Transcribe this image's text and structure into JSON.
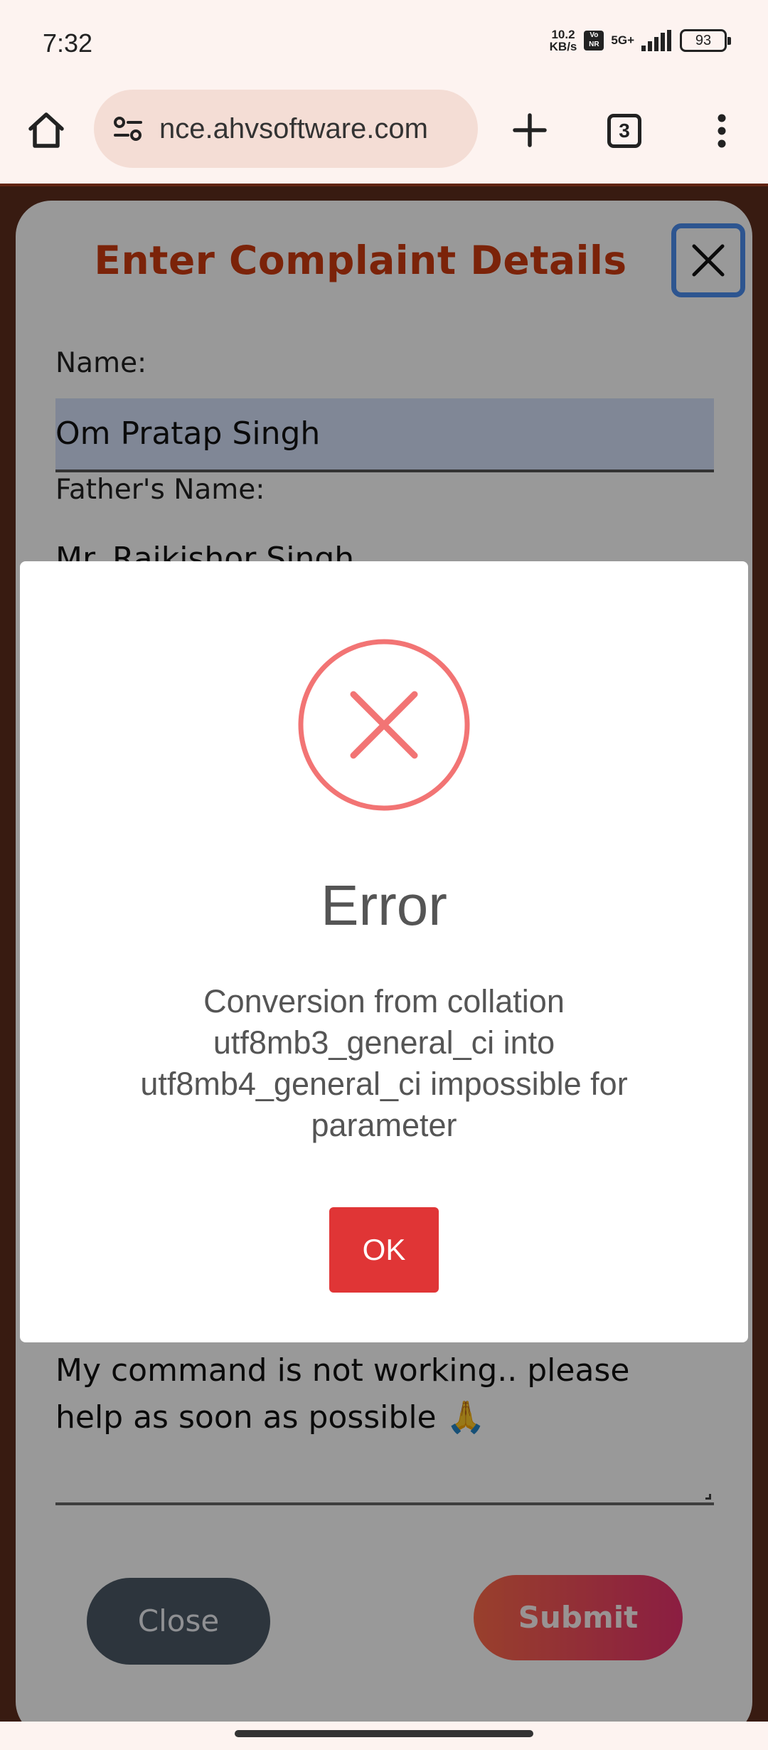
{
  "status_bar": {
    "time": "7:32",
    "net_speed_value": "10.2",
    "net_speed_unit": "KB/s",
    "volte_top": "Vo",
    "volte_bottom": "NR",
    "network": "5G+",
    "battery": "93"
  },
  "browser": {
    "url": "nce.ahvsoftware.com",
    "tab_count": "3",
    "icons": [
      "home-icon",
      "site-settings-icon",
      "plus-icon",
      "tabs-icon",
      "more-vert-icon"
    ]
  },
  "complaint_form": {
    "title": "Enter Complaint Details",
    "name_label": "Name:",
    "name_value": "Om Pratap Singh",
    "father_label": "Father's Name:",
    "father_value": "Mr. Rajkishor Singh",
    "complaint_value": "My command is not working.. please help as soon as possible 🙏",
    "close_label": "Close",
    "submit_label": "Submit"
  },
  "error_dialog": {
    "title": "Error",
    "message": "Conversion from collation utf8mb3_general_ci into utf8mb4_general_ci impossible for parameter",
    "ok_label": "OK"
  },
  "colors": {
    "title": "#cd3b10",
    "error_icon": "#f27474",
    "ok_button": "#e03536",
    "close_button": "#4c5966",
    "focus_ring": "#4c8ef0"
  }
}
